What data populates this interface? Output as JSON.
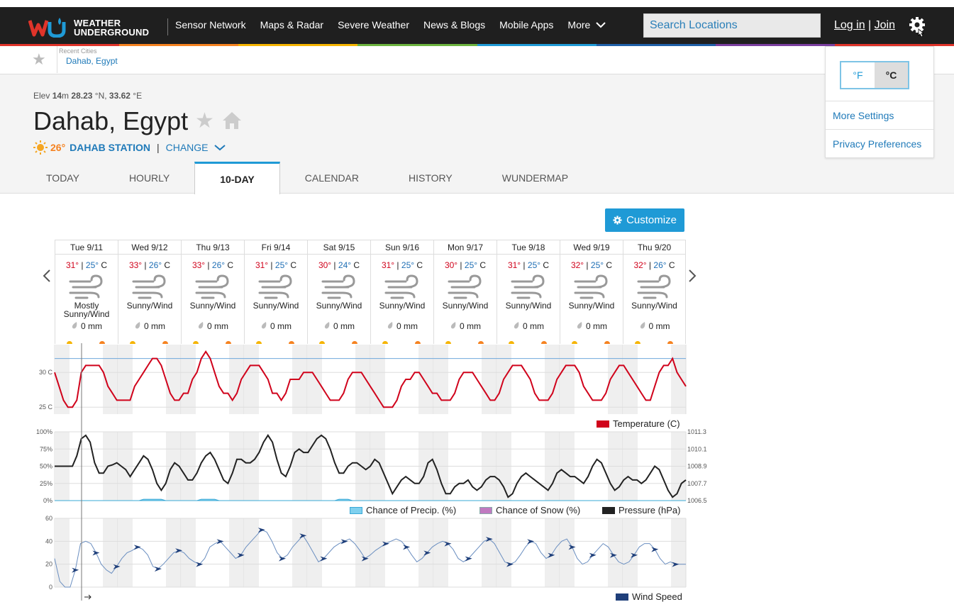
{
  "nav": {
    "logo_text_1": "WEATHER",
    "logo_text_2": "UNDERGROUND",
    "items": [
      "Sensor Network",
      "Maps & Radar",
      "Severe Weather",
      "News & Blogs",
      "Mobile Apps",
      "More"
    ],
    "search_placeholder": "Search Locations",
    "login": "Log in",
    "auth_sep": "|",
    "join": "Join"
  },
  "colors": {
    "stripe": [
      "#e0342a",
      "#f58220",
      "#f5b400",
      "#6cb33f",
      "#1f9ad6",
      "#1f5fa8",
      "#7b3fa0",
      "#e0342a"
    ],
    "accent": "#1f9ad6",
    "temp_line": "#d0021b",
    "pressure_line": "#222222",
    "precip_fill": "#7fd0ee",
    "wind_line": "#1f3f7a"
  },
  "recent": {
    "label": "Recent Cities",
    "city": "Dahab, Egypt"
  },
  "location": {
    "elev_prefix": "Elev",
    "elev_value": "14",
    "elev_unit": "m",
    "lat": "28.23",
    "lat_unit": "°N,",
    "lon": "33.62",
    "lon_unit": "°E",
    "name": "Dahab, Egypt",
    "station_temp": "26°",
    "station_name": "DAHAB STATION",
    "sep": "|",
    "change": "CHANGE"
  },
  "tabs": [
    "TODAY",
    "HOURLY",
    "10-DAY",
    "CALENDAR",
    "HISTORY",
    "WUNDERMAP"
  ],
  "active_tab": "10-DAY",
  "settings": {
    "unit_f": "°F",
    "unit_c": "°C",
    "more_settings": "More Settings",
    "privacy": "Privacy Preferences"
  },
  "customize_label": "Customize",
  "days": [
    {
      "date": "Tue 9/11",
      "hi": "31°",
      "lo": "25°",
      "unit": "C",
      "cond": "Mostly Sunny/Wind",
      "precip": "0 mm"
    },
    {
      "date": "Wed 9/12",
      "hi": "33°",
      "lo": "26°",
      "unit": "C",
      "cond": "Sunny/Wind",
      "precip": "0 mm"
    },
    {
      "date": "Thu 9/13",
      "hi": "33°",
      "lo": "26°",
      "unit": "C",
      "cond": "Sunny/Wind",
      "precip": "0 mm"
    },
    {
      "date": "Fri 9/14",
      "hi": "31°",
      "lo": "25°",
      "unit": "C",
      "cond": "Sunny/Wind",
      "precip": "0 mm"
    },
    {
      "date": "Sat 9/15",
      "hi": "30°",
      "lo": "24°",
      "unit": "C",
      "cond": "Sunny/Wind",
      "precip": "0 mm"
    },
    {
      "date": "Sun 9/16",
      "hi": "31°",
      "lo": "25°",
      "unit": "C",
      "cond": "Sunny/Wind",
      "precip": "0 mm"
    },
    {
      "date": "Mon 9/17",
      "hi": "30°",
      "lo": "25°",
      "unit": "C",
      "cond": "Sunny/Wind",
      "precip": "0 mm"
    },
    {
      "date": "Tue 9/18",
      "hi": "31°",
      "lo": "25°",
      "unit": "C",
      "cond": "Sunny/Wind",
      "precip": "0 mm"
    },
    {
      "date": "Wed 9/19",
      "hi": "32°",
      "lo": "25°",
      "unit": "C",
      "cond": "Sunny/Wind",
      "precip": "0 mm"
    },
    {
      "date": "Thu 9/20",
      "hi": "32°",
      "lo": "26°",
      "unit": "C",
      "cond": "Sunny/Wind",
      "precip": "0 mm"
    }
  ],
  "chart_data": [
    {
      "type": "line",
      "ylabel_ticks": [
        "30 C",
        "25 C"
      ],
      "ylim": [
        24,
        34
      ],
      "series": [
        {
          "name": "Temperature (C)",
          "values": [
            30,
            28,
            26,
            25,
            25,
            26,
            30,
            31,
            31,
            31,
            31,
            30,
            28,
            27,
            26,
            26,
            26,
            26,
            28,
            29,
            30,
            31,
            32,
            32,
            31,
            29,
            27,
            26,
            26,
            27,
            27,
            29,
            30,
            32,
            33,
            32,
            30,
            28,
            27,
            27,
            26,
            27,
            29,
            30,
            31,
            31,
            31,
            30,
            29,
            27,
            27,
            26,
            27,
            29,
            29,
            29,
            30,
            30,
            30,
            29,
            28,
            27,
            26,
            26,
            26,
            27,
            29,
            30,
            30,
            30,
            29,
            28,
            27,
            26,
            25,
            25,
            25,
            26,
            28,
            29,
            29,
            30,
            30,
            29,
            28,
            27,
            27,
            26,
            26,
            26,
            27,
            29,
            30,
            30,
            30,
            29,
            28,
            27,
            26,
            26,
            27,
            29,
            30,
            31,
            31,
            31,
            30,
            29,
            27,
            26,
            26,
            26,
            27,
            29,
            30,
            31,
            31,
            31,
            30,
            28,
            27,
            26,
            26,
            26,
            27,
            29,
            30,
            31,
            31,
            30,
            29,
            28,
            27,
            26,
            26,
            28,
            30,
            31,
            31,
            32,
            30,
            29,
            28
          ]
        }
      ],
      "reference_line": 32
    },
    {
      "type": "line",
      "yticks_left": [
        "100%",
        "75%",
        "50%",
        "25%",
        "0%"
      ],
      "yticks_right": [
        "1011.3",
        "1010.1",
        "1008.9",
        "1007.7",
        "1006.5"
      ],
      "series": [
        {
          "name": "Chance of Precip. (%)",
          "values": [
            0,
            0,
            0,
            0,
            0,
            0,
            0,
            0,
            0,
            0,
            0,
            0,
            0,
            0,
            0,
            0,
            0,
            0,
            0,
            0,
            2,
            2,
            2,
            2,
            2,
            0,
            0,
            0,
            0,
            0,
            0,
            0,
            0,
            2,
            2,
            2,
            2,
            0,
            0,
            0,
            0,
            0,
            0,
            0,
            0,
            0,
            0,
            0,
            0,
            0,
            0,
            0,
            0,
            0,
            0,
            0,
            0,
            0,
            0,
            0,
            0,
            0,
            0,
            0,
            2,
            2,
            2,
            0,
            0,
            0,
            0,
            0,
            0,
            0,
            0,
            0,
            0,
            0,
            0,
            0,
            0,
            0,
            0,
            0,
            0,
            0,
            0,
            0,
            0,
            0,
            0,
            0,
            0,
            0,
            0,
            0,
            0,
            0,
            0,
            0,
            0,
            0,
            0,
            0,
            0,
            0,
            0,
            0,
            0,
            0,
            0,
            0,
            0,
            0,
            0,
            0,
            0,
            0,
            0,
            0,
            0,
            0,
            0,
            0,
            0,
            0,
            0,
            0,
            0,
            0,
            0,
            0,
            0,
            0,
            0,
            0,
            0,
            0,
            0,
            0,
            0,
            0,
            0
          ]
        },
        {
          "name": "Chance of Snow (%)",
          "values": []
        },
        {
          "name": "Pressure (hPa)",
          "values": [
            50,
            50,
            50,
            50,
            50,
            65,
            90,
            95,
            85,
            55,
            40,
            40,
            50,
            52,
            55,
            50,
            45,
            35,
            45,
            55,
            65,
            60,
            45,
            25,
            15,
            25,
            45,
            55,
            50,
            40,
            30,
            30,
            40,
            55,
            65,
            70,
            60,
            45,
            30,
            25,
            40,
            60,
            60,
            55,
            55,
            60,
            70,
            85,
            95,
            85,
            60,
            40,
            35,
            50,
            70,
            75,
            70,
            70,
            80,
            90,
            95,
            90,
            75,
            55,
            40,
            40,
            50,
            55,
            55,
            50,
            45,
            50,
            60,
            55,
            40,
            25,
            10,
            20,
            30,
            35,
            30,
            25,
            25,
            35,
            55,
            60,
            45,
            25,
            10,
            10,
            20,
            25,
            25,
            30,
            20,
            15,
            20,
            30,
            35,
            35,
            30,
            20,
            5,
            10,
            25,
            35,
            40,
            35,
            30,
            25,
            20,
            15,
            25,
            40,
            45,
            40,
            35,
            35,
            30,
            25,
            35,
            50,
            60,
            55,
            40,
            25,
            15,
            20,
            30,
            35,
            30,
            30,
            25,
            30,
            40,
            50,
            45,
            30,
            15,
            5,
            10,
            25,
            30
          ]
        }
      ]
    },
    {
      "type": "line",
      "yticks": [
        "60",
        "40",
        "20",
        "0"
      ],
      "ylim": [
        0,
        60
      ],
      "series": [
        {
          "name": "Wind Speed",
          "values": [
            25,
            5,
            0,
            0,
            15,
            38,
            40,
            38,
            30,
            20,
            15,
            12,
            18,
            25,
            30,
            32,
            35,
            33,
            28,
            18,
            16,
            20,
            25,
            30,
            32,
            30,
            25,
            22,
            20,
            25,
            35,
            38,
            40,
            35,
            30,
            25,
            28,
            35,
            40,
            45,
            50,
            48,
            40,
            30,
            25,
            28,
            35,
            40,
            45,
            38,
            30,
            22,
            25,
            30,
            35,
            38,
            40,
            42,
            38,
            32,
            25,
            28,
            32,
            35,
            38,
            40,
            42,
            40,
            35,
            28,
            22,
            25,
            30,
            35,
            38,
            40,
            38,
            33,
            25,
            22,
            25,
            30,
            35,
            40,
            42,
            38,
            30,
            22,
            20,
            22,
            28,
            35,
            40,
            38,
            30,
            25,
            28,
            35,
            40,
            42,
            35,
            25,
            20,
            22,
            28,
            33,
            38,
            35,
            28,
            22,
            20,
            22,
            28,
            35,
            38,
            38,
            33,
            25,
            20,
            22,
            20,
            20,
            20
          ]
        }
      ]
    }
  ]
}
